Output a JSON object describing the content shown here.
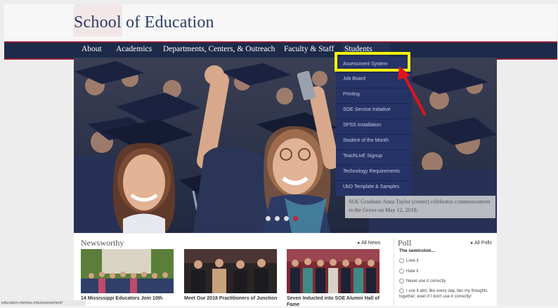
{
  "header": {
    "title": "School of Education"
  },
  "nav": {
    "items": [
      {
        "label": "About"
      },
      {
        "label": "Academics"
      },
      {
        "label": "Departments, Centers, & Outreach"
      },
      {
        "label": "Faculty & Staff"
      },
      {
        "label": "Students"
      }
    ]
  },
  "students_menu": {
    "items": [
      {
        "label": "Assessment System"
      },
      {
        "label": "Job Board"
      },
      {
        "label": "Printing"
      },
      {
        "label": "SOE Service Initiative"
      },
      {
        "label": "SPSS Installation"
      },
      {
        "label": "Student of the Month"
      },
      {
        "label": "TeachLivE Signup"
      },
      {
        "label": "Technology Requirements"
      },
      {
        "label": "UbD Template & Samples"
      }
    ]
  },
  "hero": {
    "caption": "SOE Graduate Anna Taylor (center) celebrates commencement in the Grove on May 12, 2018."
  },
  "news": {
    "title": "Newsworthy",
    "all_label": "All News",
    "items": [
      {
        "headline": "14 Mississippi Educators Join 10th"
      },
      {
        "headline": "Meet Our 2018 Practitioners of Junction"
      },
      {
        "headline": "Seven Inducted into SOE Alumni Hall of Fame"
      }
    ]
  },
  "poll": {
    "title": "Poll",
    "all_label": "All Polls",
    "question": "The semicolon...",
    "options": [
      {
        "label": "Love it"
      },
      {
        "label": "Hate it"
      },
      {
        "label": "Never use it correctly"
      },
      {
        "label": "I use it alot; like every day, ties my thoughts together; even if I don't use it correctly!"
      }
    ]
  },
  "status": {
    "url": "education.olemiss.edu/assessment/"
  },
  "colors": {
    "navy": "#1d2a4a",
    "crimson": "#8c1c2f",
    "highlight": "#f4f20b",
    "arrow": "#e0141e"
  }
}
